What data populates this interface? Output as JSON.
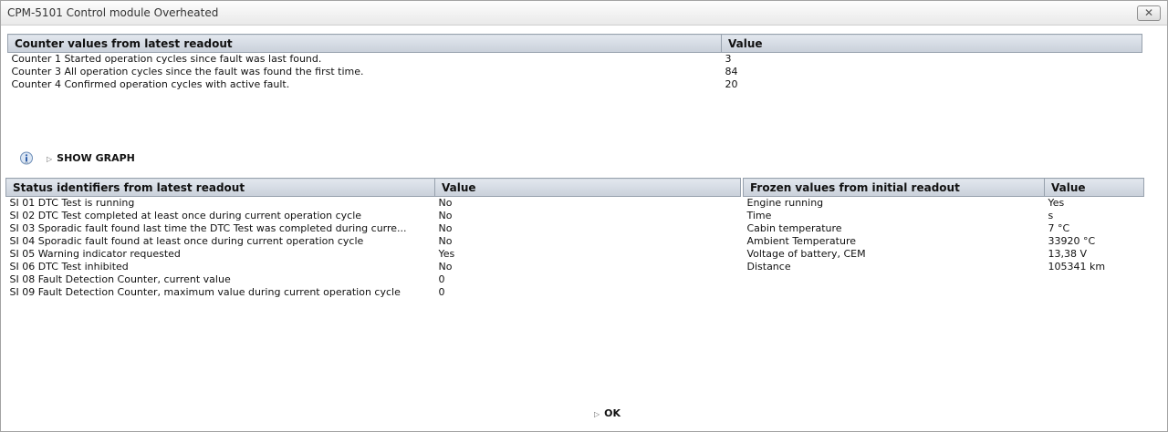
{
  "window": {
    "title": "CPM-5101 Control module Overheated",
    "close_glyph": "✕"
  },
  "counters": {
    "headers": [
      "Counter values from latest readout",
      "Value"
    ],
    "rows": [
      [
        "Counter 1 Started operation cycles since fault was last found.",
        "3"
      ],
      [
        "Counter 3 All operation cycles since the fault was found the first time.",
        "84"
      ],
      [
        "Counter 4 Confirmed operation cycles with active fault.",
        "20"
      ]
    ]
  },
  "graph": {
    "label": "SHOW GRAPH",
    "icon": "info-icon"
  },
  "status": {
    "headers": [
      "Status identifiers from latest readout",
      "Value"
    ],
    "rows": [
      [
        "SI 01 DTC Test is running",
        "No"
      ],
      [
        "SI 02 DTC Test completed at least once during current operation cycle",
        "No"
      ],
      [
        "SI 03 Sporadic fault found last time the DTC Test was completed during curre...",
        "No"
      ],
      [
        "SI 04 Sporadic fault found at least once during current operation cycle",
        "No"
      ],
      [
        "SI 05 Warning indicator requested",
        "Yes"
      ],
      [
        "SI 06 DTC Test inhibited",
        "No"
      ],
      [
        "SI 08 Fault Detection Counter, current value",
        "0"
      ],
      [
        "SI 09 Fault Detection Counter, maximum value during current operation cycle",
        "0"
      ]
    ]
  },
  "frozen": {
    "headers": [
      "Frozen values from initial readout",
      "Value"
    ],
    "rows": [
      [
        "Engine running",
        "Yes"
      ],
      [
        "Time",
        "s"
      ],
      [
        "Cabin temperature",
        "7 °C"
      ],
      [
        "Ambient Temperature",
        "33920 °C"
      ],
      [
        "Voltage of battery, CEM",
        "13,38 V"
      ],
      [
        "Distance",
        "105341 km"
      ]
    ]
  },
  "footer": {
    "ok_label": "OK"
  }
}
